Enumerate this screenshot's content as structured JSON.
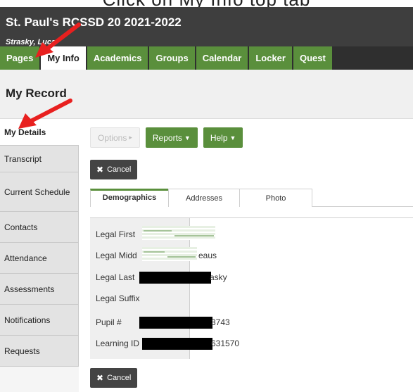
{
  "caption": "Click on My Info top tab",
  "header": {
    "school": "St. Paul's RCSSD 20 2021-2022",
    "user": "Strasky, Luca"
  },
  "nav": {
    "tabs": [
      "Pages",
      "My Info",
      "Academics",
      "Groups",
      "Calendar",
      "Locker",
      "Quest"
    ],
    "active": "My Info"
  },
  "record": {
    "title": "My Record"
  },
  "sidebar": {
    "items": [
      "My Details",
      "Transcript",
      "Current Schedule",
      "Contacts",
      "Attendance",
      "Assessments",
      "Notifications",
      "Requests"
    ]
  },
  "toolbar": {
    "options": "Options",
    "reports": "Reports",
    "help": "Help"
  },
  "cancel_label": "Cancel",
  "subtabs": [
    "Demographics",
    "Addresses",
    "Photo"
  ],
  "form": {
    "fields": [
      {
        "label": "Legal First",
        "value": ""
      },
      {
        "label": "Legal Midd",
        "value": "eaus"
      },
      {
        "label": "Legal Last",
        "value": "asky"
      },
      {
        "label": "Legal Suffix",
        "value": ""
      },
      {
        "label": "Pupil #",
        "value": "3743"
      },
      {
        "label": "Learning ID",
        "value": "631570"
      }
    ]
  },
  "colors": {
    "accent_green": "#5a8f3c",
    "header_dark": "#3e3e3e",
    "arrow_red": "#e8201f"
  }
}
